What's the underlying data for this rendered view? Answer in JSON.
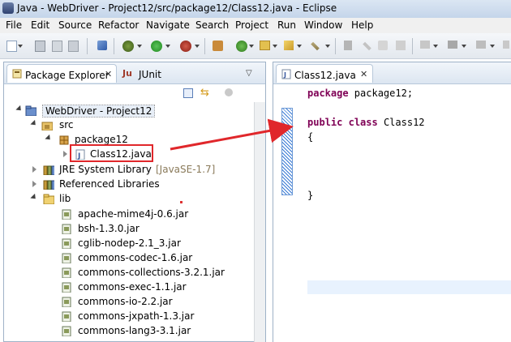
{
  "window": {
    "title": "Java - WebDriver - Project12/src/package12/Class12.java - Eclipse"
  },
  "menubar": [
    "File",
    "Edit",
    "Source",
    "Refactor",
    "Navigate",
    "Search",
    "Project",
    "Run",
    "Window",
    "Help"
  ],
  "views": {
    "package_explorer_tab": "Package Explorer",
    "junit_tab": "JUnit"
  },
  "tree": {
    "project": "WebDriver - Project12",
    "src": "src",
    "package": "package12",
    "file": "Class12.java",
    "jre": "JRE System Library",
    "jre_decoration": "[JavaSE-1.7]",
    "referenced": "Referenced Libraries",
    "lib": "lib",
    "jars": [
      "apache-mime4j-0.6.jar",
      "bsh-1.3.0.jar",
      "cglib-nodep-2.1_3.jar",
      "commons-codec-1.6.jar",
      "commons-collections-3.2.1.jar",
      "commons-exec-1.1.jar",
      "commons-io-2.2.jar",
      "commons-jxpath-1.3.jar",
      "commons-lang3-3.1.jar"
    ]
  },
  "editor": {
    "tab_title": "Class12.java",
    "lines": {
      "l1_kw": "package",
      "l1_rest": " package12;",
      "l3_kw1": "public",
      "l3_kw2": "class",
      "l3_rest": " Class12",
      "l4": "{",
      "l8": "}"
    }
  },
  "icons": {
    "app": "eclipse-icon",
    "package_explorer": "package-explorer-icon",
    "junit": "junit-icon",
    "project": "java-project-icon",
    "folder": "source-folder-icon",
    "package": "package-icon",
    "java_file": "java-file-icon",
    "library": "library-icon",
    "jar": "jar-icon"
  },
  "colors": {
    "annotation": "#e0272b",
    "keyword": "#7f0055",
    "selection_blue": "#3a7bd5"
  }
}
